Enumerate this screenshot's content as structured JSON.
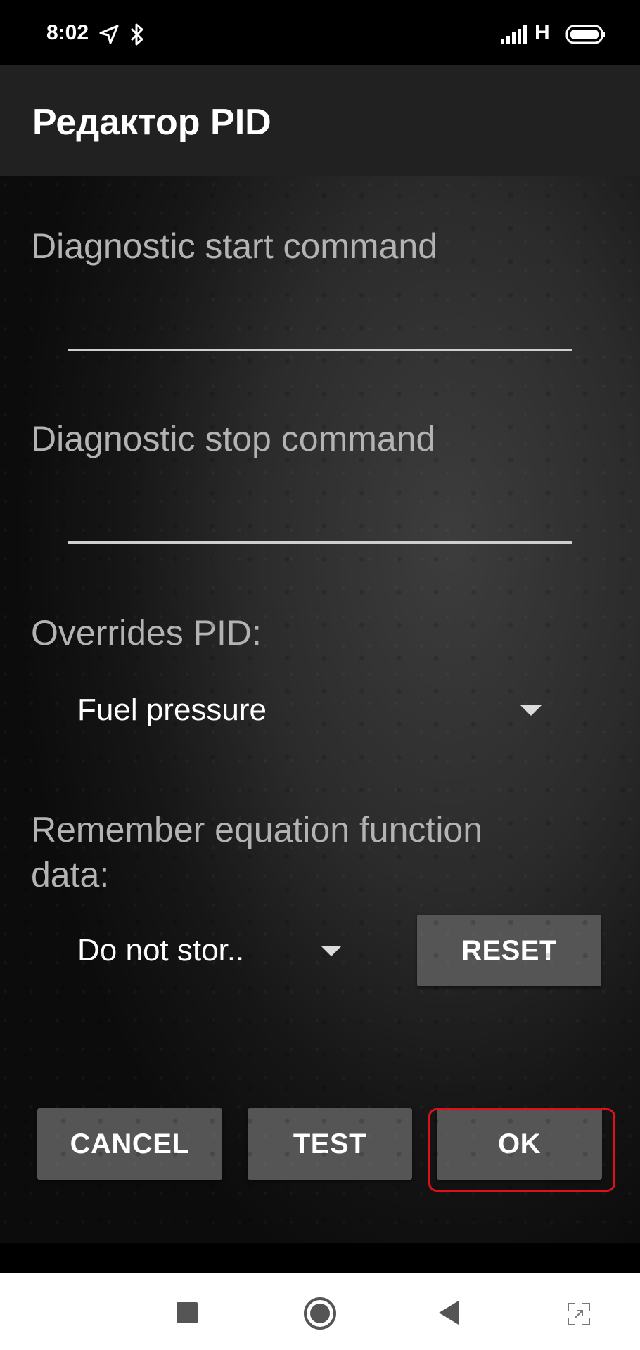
{
  "status_bar": {
    "time": "8:02",
    "network_label": "H",
    "icons": [
      "navigation-icon",
      "bluetooth-icon",
      "signal-icon",
      "battery-icon"
    ]
  },
  "app_bar": {
    "title": "Редактор PID"
  },
  "form": {
    "start_command": {
      "label": "Diagnostic start command",
      "value": ""
    },
    "stop_command": {
      "label": "Diagnostic stop command",
      "value": ""
    },
    "overrides_pid": {
      "label": "Overrides PID:",
      "selected": "Fuel pressure"
    },
    "remember_data": {
      "label_line1": "Remember equation function",
      "label_line2": "data:",
      "selected": "Do not stor.."
    },
    "reset_label": "RESET"
  },
  "actions": {
    "cancel_label": "CANCEL",
    "test_label": "TEST",
    "ok_label": "OK",
    "highlight_color": "#e0101a"
  },
  "nav_bar": {
    "icons": [
      "recents-square-icon",
      "home-circle-icon",
      "back-triangle-icon",
      "fullscreen-icon"
    ]
  },
  "colors": {
    "app_bar": "#212121",
    "button": "#555555",
    "label": "#b3b3b3"
  }
}
